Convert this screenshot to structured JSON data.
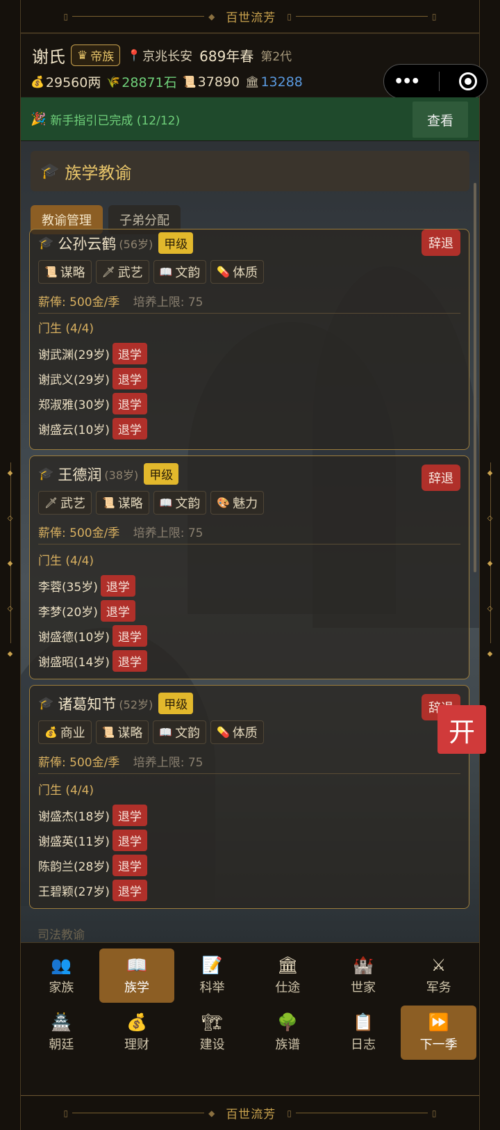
{
  "banner": {
    "title": "百世流芳"
  },
  "header": {
    "clan_name": "谢氏",
    "badge": "帝族",
    "location": "京兆长安",
    "year": "689年春",
    "generation": "第2代",
    "resources": [
      {
        "icon": "money-bag-icon",
        "value": "29560两",
        "color": "#e8dcc0"
      },
      {
        "icon": "grain-icon",
        "value": "28871石",
        "color": "#6fd07a"
      },
      {
        "icon": "scroll-icon",
        "value": "37890",
        "color": "#e8dcc0"
      },
      {
        "icon": "building-icon",
        "value": "13288",
        "color": "#5a9ae0"
      }
    ]
  },
  "guide": {
    "text": "新手指引已完成 (12/12)",
    "button": "查看"
  },
  "section": {
    "title": "族学教谕"
  },
  "tabs": [
    {
      "label": "教谕管理",
      "active": true
    },
    {
      "label": "子弟分配",
      "active": false
    }
  ],
  "teachers": [
    {
      "name": "公孙云鹤",
      "age": "(56岁)",
      "grade": "甲级",
      "dismiss": "辞退",
      "skills": [
        {
          "icon": "scroll-icon",
          "label": "谋略"
        },
        {
          "icon": "sword-icon",
          "label": "武艺"
        },
        {
          "icon": "book-icon",
          "label": "文韵"
        },
        {
          "icon": "pill-icon",
          "label": "体质"
        }
      ],
      "salary": "薪俸: 500金/季",
      "cap": "培养上限: 75",
      "pupil_head": "门生 (4/4)",
      "pupils": [
        {
          "name": "谢武渊(29岁)",
          "action": "退学"
        },
        {
          "name": "谢武义(29岁)",
          "action": "退学"
        },
        {
          "name": "郑淑雅(30岁)",
          "action": "退学"
        },
        {
          "name": "谢盛云(10岁)",
          "action": "退学"
        }
      ]
    },
    {
      "name": "王德润",
      "age": "(38岁)",
      "grade": "甲级",
      "dismiss": "辞退",
      "skills": [
        {
          "icon": "sword-icon",
          "label": "武艺"
        },
        {
          "icon": "scroll-icon",
          "label": "谋略"
        },
        {
          "icon": "book-icon",
          "label": "文韵"
        },
        {
          "icon": "palette-icon",
          "label": "魅力"
        }
      ],
      "salary": "薪俸: 500金/季",
      "cap": "培养上限: 75",
      "pupil_head": "门生 (4/4)",
      "pupils": [
        {
          "name": "李蓉(35岁)",
          "action": "退学"
        },
        {
          "name": "李梦(20岁)",
          "action": "退学"
        },
        {
          "name": "谢盛德(10岁)",
          "action": "退学"
        },
        {
          "name": "谢盛昭(14岁)",
          "action": "退学"
        }
      ]
    },
    {
      "name": "诸葛知节",
      "age": "(52岁)",
      "grade": "甲级",
      "dismiss": "辞退",
      "skills": [
        {
          "icon": "money-bag-icon",
          "label": "商业"
        },
        {
          "icon": "scroll-icon",
          "label": "谋略"
        },
        {
          "icon": "book-icon",
          "label": "文韵"
        },
        {
          "icon": "pill-icon",
          "label": "体质"
        }
      ],
      "salary": "薪俸: 500金/季",
      "cap": "培养上限: 75",
      "pupil_head": "门生 (4/4)",
      "pupils": [
        {
          "name": "谢盛杰(18岁)",
          "action": "退学"
        },
        {
          "name": "谢盛英(11岁)",
          "action": "退学"
        },
        {
          "name": "陈韵兰(28岁)",
          "action": "退学"
        },
        {
          "name": "王碧颖(27岁)",
          "action": "退学"
        }
      ]
    }
  ],
  "next_section": "司法教谕",
  "fab": "开",
  "nav": [
    {
      "icon": "family-icon",
      "label": "家族",
      "active": false
    },
    {
      "icon": "book-icon",
      "label": "族学",
      "active": true
    },
    {
      "icon": "exam-icon",
      "label": "科举",
      "active": false
    },
    {
      "icon": "building-icon",
      "label": "仕途",
      "active": false
    },
    {
      "icon": "castle-icon",
      "label": "世家",
      "active": false
    },
    {
      "icon": "crossed-swords-icon",
      "label": "军务",
      "active": false
    },
    {
      "icon": "court-icon",
      "label": "朝廷",
      "active": false
    },
    {
      "icon": "money-bag-icon",
      "label": "理财",
      "active": false
    },
    {
      "icon": "crane-icon",
      "label": "建设",
      "active": false
    },
    {
      "icon": "tree-icon",
      "label": "族谱",
      "active": false
    },
    {
      "icon": "clipboard-icon",
      "label": "日志",
      "active": false
    },
    {
      "icon": "fast-forward-icon",
      "label": "下一季",
      "active": true
    }
  ]
}
